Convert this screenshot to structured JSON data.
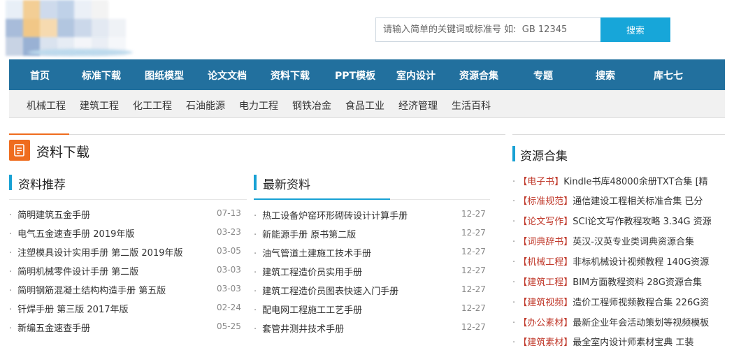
{
  "search": {
    "placeholder": "请输入简单的关键词或标准号 如:  GB 12345",
    "button_label": "搜索"
  },
  "nav": {
    "items": [
      "首页",
      "标准下载",
      "图纸模型",
      "论文文档",
      "资料下载",
      "PPT模板",
      "室内设计",
      "资源合集",
      "专题",
      "搜索",
      "库七七"
    ]
  },
  "subnav": {
    "items": [
      "机械工程",
      "建筑工程",
      "化工工程",
      "石油能源",
      "电力工程",
      "钢铁冶金",
      "食品工业",
      "经济管理",
      "生活百科"
    ]
  },
  "section": {
    "title": "资料下载"
  },
  "recommend": {
    "title": "资料推荐",
    "items": [
      {
        "title": "简明建筑五金手册",
        "date": "07-13"
      },
      {
        "title": "电气五金速查手册 2019年版",
        "date": "03-23"
      },
      {
        "title": "注塑模具设计实用手册 第二版 2019年版",
        "date": "03-05"
      },
      {
        "title": "简明机械零件设计手册 第二版",
        "date": "03-03"
      },
      {
        "title": "简明钢筋混凝土结构构造手册 第五版",
        "date": "03-03"
      },
      {
        "title": "钎焊手册 第三版 2017年版",
        "date": "02-24"
      },
      {
        "title": "新编五金速查手册",
        "date": "05-25"
      }
    ]
  },
  "latest": {
    "title": "最新资料",
    "items": [
      {
        "title": "热工设备炉窑环形砌砖设计计算手册",
        "date": "12-27"
      },
      {
        "title": "新能源手册 原书第二版",
        "date": "12-27"
      },
      {
        "title": "油气管道土建施工技术手册",
        "date": "12-27"
      },
      {
        "title": "建筑工程造价员实用手册",
        "date": "12-27"
      },
      {
        "title": "建筑工程造价员图表快速入门手册",
        "date": "12-27"
      },
      {
        "title": "配电网工程施工工艺手册",
        "date": "12-27"
      },
      {
        "title": "套管井测井技术手册",
        "date": "12-27"
      }
    ]
  },
  "collections": {
    "title": "资源合集",
    "items": [
      {
        "tag": "【电子书】",
        "text": "Kindle书库48000余册TXT合集 [精"
      },
      {
        "tag": "【标准规范】",
        "text": "通信建设工程相关标准合集 已分"
      },
      {
        "tag": "【论文写作】",
        "text": "SCI论文写作教程攻略 3.34G 资源"
      },
      {
        "tag": "【词典辞书】",
        "text": "英汉-汉英专业类词典资源合集"
      },
      {
        "tag": "【机械工程】",
        "text": "非标机械设计视频教程 140G资源"
      },
      {
        "tag": "【建筑工程】",
        "text": "BIM方面教程资料 28G资源合集"
      },
      {
        "tag": "【建筑视频】",
        "text": "造价工程师视频教程合集 226G资"
      },
      {
        "tag": "【办公素材】",
        "text": "最新企业年会活动策划等视频模板"
      },
      {
        "tag": "【建筑素材】",
        "text": "最全室内设计师素材宝典 工装"
      }
    ]
  },
  "colors": {
    "nav_bg": "#22709e",
    "accent_blue": "#18a1d4",
    "accent_orange": "#ef6c1e",
    "tag_red": "#c0392b"
  }
}
